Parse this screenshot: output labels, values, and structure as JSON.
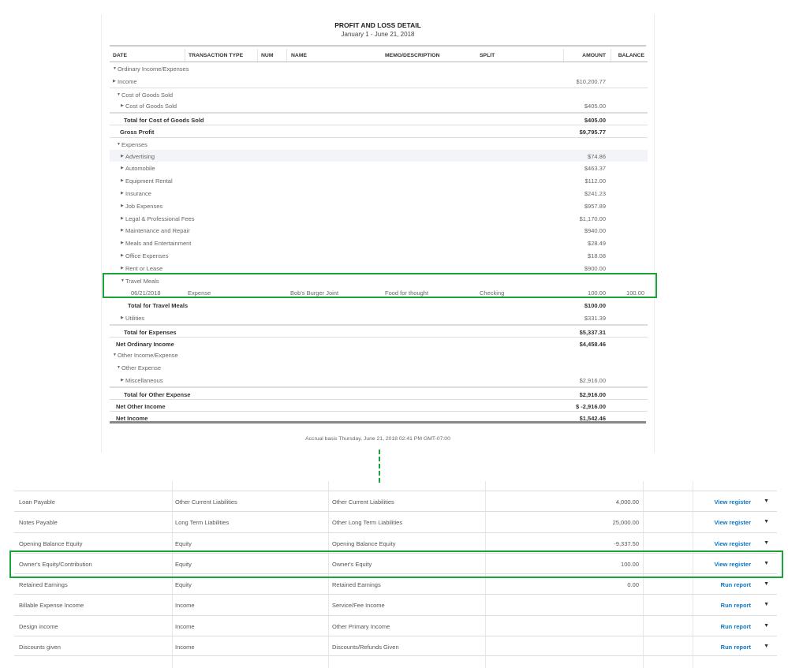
{
  "report": {
    "title": "PROFIT AND LOSS DETAIL",
    "date_range": "January 1 - June 21, 2018",
    "columns": [
      "DATE",
      "TRANSACTION TYPE",
      "NUM",
      "NAME",
      "MEMO/DESCRIPTION",
      "SPLIT",
      "AMOUNT",
      "BALANCE"
    ],
    "rows": [
      {
        "label": "Ordinary Income/Expenses",
        "level": 0,
        "toggle": "down",
        "amount": ""
      },
      {
        "label": "Income",
        "level": 0,
        "toggle": "right",
        "amount": "$10,200.77"
      },
      {
        "label": "Cost of Goods Sold",
        "level": 1,
        "toggle": "down",
        "amount": "",
        "border": 1
      },
      {
        "label": "Cost of Goods Sold",
        "level": 2,
        "toggle": "right",
        "amount": "$405.00"
      },
      {
        "label": "Total for Cost of Goods Sold",
        "level": 2,
        "bold": true,
        "amount": "$405.00",
        "border": 2
      },
      {
        "label": "Gross Profit",
        "level": 1,
        "bold": true,
        "amount": "$9,795.77",
        "border": 1
      },
      {
        "label": "Expenses",
        "level": 1,
        "toggle": "down",
        "amount": "",
        "border": 1
      },
      {
        "label": "Advertising",
        "level": 2,
        "toggle": "right",
        "amount": "$74.86",
        "shade": true
      },
      {
        "label": "Automobile",
        "level": 2,
        "toggle": "right",
        "amount": "$463.37"
      },
      {
        "label": "Equipment Rental",
        "level": 2,
        "toggle": "right",
        "amount": "$112.00"
      },
      {
        "label": "Insurance",
        "level": 2,
        "toggle": "right",
        "amount": "$241.23"
      },
      {
        "label": "Job Expenses",
        "level": 2,
        "toggle": "right",
        "amount": "$957.89"
      },
      {
        "label": "Legal & Professional Fees",
        "level": 2,
        "toggle": "right",
        "amount": "$1,170.00"
      },
      {
        "label": "Maintenance and Repair",
        "level": 2,
        "toggle": "right",
        "amount": "$940.00"
      },
      {
        "label": "Meals and Entertainment",
        "level": 2,
        "toggle": "right",
        "amount": "$28.49"
      },
      {
        "label": "Office Expenses",
        "level": 2,
        "toggle": "right",
        "amount": "$18.08"
      },
      {
        "label": "Rent or Lease",
        "level": 2,
        "toggle": "right",
        "amount": "$900.00"
      },
      {
        "label": "Travel Meals",
        "level": 2,
        "toggle": "down",
        "amount": ""
      },
      {
        "txn": true,
        "date": "06/21/2018",
        "type": "Expense",
        "num": "",
        "name": "Bob's Burger Joint",
        "memo": "Food for thought",
        "split": "Checking",
        "amount": "100.00",
        "balance": "100.00"
      },
      {
        "label": "Total for Travel Meals",
        "level": 3,
        "bold": true,
        "amount": "$100.00"
      },
      {
        "label": "Utilities",
        "level": 2,
        "toggle": "right",
        "amount": "$331.39"
      },
      {
        "label": "Total for Expenses",
        "level": 2,
        "bold": true,
        "amount": "$5,337.31",
        "border": 2
      },
      {
        "label": "Net Ordinary Income",
        "level": 0,
        "bold": true,
        "amount": "$4,458.46",
        "border": 1
      },
      {
        "label": "Other Income/Expense",
        "level": 0,
        "toggle": "down",
        "amount": ""
      },
      {
        "label": "Other Expense",
        "level": 1,
        "toggle": "down",
        "amount": ""
      },
      {
        "label": "Miscellaneous",
        "level": 2,
        "toggle": "right",
        "amount": "$2,916.00"
      },
      {
        "label": "Total for Other Expense",
        "level": 2,
        "bold": true,
        "amount": "$2,916.00",
        "border": 2
      },
      {
        "label": "Net Other Income",
        "level": 0,
        "bold": true,
        "amount": "$ -2,916.00",
        "border": 1
      },
      {
        "label": "Net Income",
        "level": 0,
        "bold": true,
        "amount": "$1,542.46",
        "border": 1
      }
    ],
    "footer": "Accrual basis  Thursday, June 21, 2018  02:41 PM GMT-07:00"
  },
  "accounts": [
    {
      "name": "Loan Payable",
      "type": "Other Current Liabilities",
      "detail": "Other Current Liabilities",
      "balance": "4,000.00",
      "action": "View register"
    },
    {
      "name": "Notes Payable",
      "type": "Long Term Liabilities",
      "detail": "Other Long Term Liabilities",
      "balance": "25,000.00",
      "action": "View register"
    },
    {
      "name": "Opening Balance Equity",
      "type": "Equity",
      "detail": "Opening Balance Equity",
      "balance": "-9,337.50",
      "action": "View register"
    },
    {
      "name": "Owner's Equity/Contribution",
      "type": "Equity",
      "detail": "Owner's Equity",
      "balance": "100.00",
      "action": "View register"
    },
    {
      "name": "Retained Earnings",
      "type": "Equity",
      "detail": "Retained Earnings",
      "balance": "0.00",
      "action": "Run report"
    },
    {
      "name": "Billable Expense Income",
      "type": "Income",
      "detail": "Service/Fee Income",
      "balance": "",
      "action": "Run report"
    },
    {
      "name": "Design income",
      "type": "Income",
      "detail": "Other Primary Income",
      "balance": "",
      "action": "Run report"
    },
    {
      "name": "Discounts given",
      "type": "Income",
      "detail": "Discounts/Refunds Given",
      "balance": "",
      "action": "Run report"
    }
  ],
  "colors": {
    "highlight": "#1aa33a",
    "link": "#0b77c5"
  }
}
